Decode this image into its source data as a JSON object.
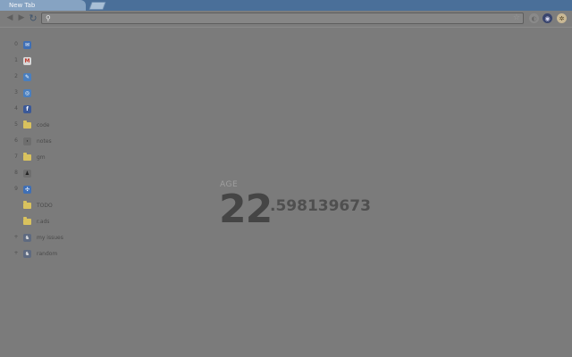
{
  "browser": {
    "tab_title": "New Tab"
  },
  "toolbar": {
    "back_icon": "◀",
    "forward_icon": "▶",
    "reload_icon": "↻",
    "search_glyph": "⚲",
    "star_icon": "☆",
    "omnibox_value": "",
    "omnibox_placeholder": ""
  },
  "bookmarks": [
    {
      "key": "0",
      "icon": "blue-icon",
      "glyph": "✉",
      "label": ""
    },
    {
      "key": "1",
      "icon": "gmail-icon",
      "glyph": "M",
      "label": ""
    },
    {
      "key": "2",
      "icon": "sky-icon",
      "glyph": "✎",
      "label": ""
    },
    {
      "key": "3",
      "icon": "globe-icon",
      "glyph": "◎",
      "label": ""
    },
    {
      "key": "4",
      "icon": "facebook-icon",
      "glyph": "f",
      "label": ""
    },
    {
      "key": "5",
      "icon": "folder-icon",
      "glyph": "",
      "label": "code"
    },
    {
      "key": "6",
      "icon": "notes-icon",
      "glyph": "·",
      "label": "notes"
    },
    {
      "key": "7",
      "icon": "folder-icon",
      "glyph": "",
      "label": "gm"
    },
    {
      "key": "8",
      "icon": "person-icon",
      "glyph": "♟",
      "label": ""
    },
    {
      "key": "9",
      "icon": "puzzle-icon",
      "glyph": "✣",
      "label": ""
    },
    {
      "key": "",
      "icon": "folder-icon",
      "glyph": "",
      "label": "TODO"
    },
    {
      "key": "",
      "icon": "folder-icon",
      "glyph": "",
      "label": "r.ads"
    },
    {
      "key": "+",
      "icon": "github-icon",
      "glyph": "♞",
      "label": "my issues"
    },
    {
      "key": "+",
      "icon": "github-icon",
      "glyph": "♞",
      "label": "random"
    }
  ],
  "age": {
    "label": "AGE",
    "integer": "22",
    "fraction": ".598139673"
  }
}
